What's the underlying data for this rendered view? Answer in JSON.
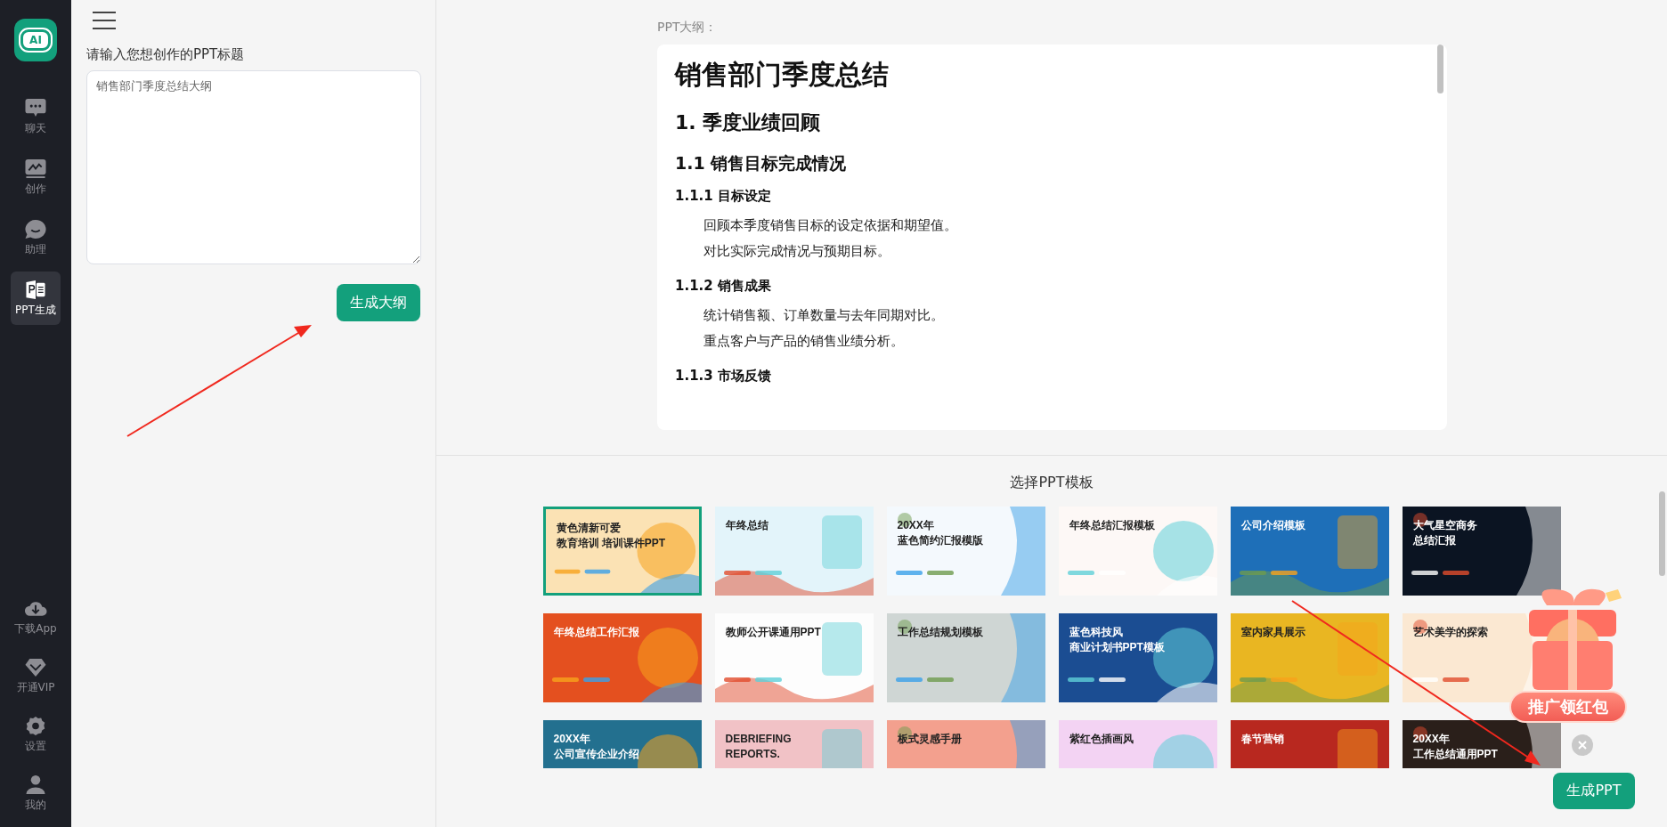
{
  "sidebar": {
    "logo": "AI",
    "items": [
      {
        "kind": "chat",
        "label": "聊天",
        "selected": false
      },
      {
        "kind": "create",
        "label": "创作",
        "selected": false
      },
      {
        "kind": "assistant",
        "label": "助理",
        "selected": false
      },
      {
        "kind": "ppt",
        "label": "PPT生成",
        "selected": true
      }
    ],
    "bottom_items": [
      {
        "kind": "download",
        "label": "下载App"
      },
      {
        "kind": "vip",
        "label": "开通VIP"
      },
      {
        "kind": "settings",
        "label": "设置"
      },
      {
        "kind": "user",
        "label": "我的"
      }
    ]
  },
  "left_panel": {
    "prompt_label": "请输入您想创作的PPT标题",
    "title_field": {
      "value": "销售部门季度总结大纲"
    },
    "generate_button": "生成大纲"
  },
  "outline": {
    "label": "PPT大纲：",
    "blocks": [
      {
        "kind": "h1",
        "text": "销售部门季度总结"
      },
      {
        "kind": "h2",
        "text": "1. 季度业绩回顾"
      },
      {
        "kind": "h3",
        "text": "1.1 销售目标完成情况"
      },
      {
        "kind": "h4",
        "text": "1.1.1 目标设定"
      },
      {
        "kind": "p",
        "text": "回顾本季度销售目标的设定依据和期望值。"
      },
      {
        "kind": "p",
        "text": "对比实际完成情况与预期目标。"
      },
      {
        "kind": "h4",
        "text": "1.1.2 销售成果"
      },
      {
        "kind": "p",
        "text": "统计销售额、订单数量与去年同期对比。"
      },
      {
        "kind": "p",
        "text": "重点客户与产品的销售业绩分析。"
      },
      {
        "kind": "h4",
        "text": "1.1.3 市场反馈"
      }
    ]
  },
  "templates": {
    "heading": "选择PPT模板",
    "items": [
      {
        "lines": [
          "黄色清新可爱",
          "教育培训 培训课件PPT"
        ],
        "color": "#fbe2b4",
        "selected": true
      },
      {
        "lines": [
          "年终总结"
        ],
        "color": "#e3f4fa",
        "selected": false
      },
      {
        "lines": [
          "20XX年",
          "蓝色简约汇报模版"
        ],
        "color": "#f4f9fd",
        "selected": false
      },
      {
        "lines": [
          "年终总结汇报模板"
        ],
        "color": "#fdf8f6",
        "selected": false
      },
      {
        "lines": [
          "公司介绍模板"
        ],
        "color": "#1e6fb8",
        "selected": false
      },
      {
        "lines": [
          "大气星空商务",
          "总结汇报"
        ],
        "color": "#0b1422",
        "selected": false
      },
      {
        "lines": [
          "年终总结工作汇报"
        ],
        "color": "#e4501f",
        "selected": false
      },
      {
        "lines": [
          "教师公开课通用PPT"
        ],
        "color": "#fdfdfd",
        "selected": false
      },
      {
        "lines": [
          "工作总结规划模板"
        ],
        "color": "#cfd6d4",
        "selected": false
      },
      {
        "lines": [
          "蓝色科技风",
          "商业计划书PPT模板"
        ],
        "color": "#1b4d92",
        "selected": false
      },
      {
        "lines": [
          "室内家具展示"
        ],
        "color": "#e9b622",
        "selected": false
      },
      {
        "lines": [
          "艺术美学的探索"
        ],
        "color": "#fbe8d2",
        "selected": false
      },
      {
        "lines": [
          "20XX年",
          "公司宣传企业介绍"
        ],
        "color": "#23708f",
        "selected": false
      },
      {
        "lines": [
          "DEBRIEFING",
          "REPORTS."
        ],
        "color": "#f1c2c6",
        "selected": false
      },
      {
        "lines": [
          "板式灵感手册"
        ],
        "color": "#f3a08e",
        "selected": false
      },
      {
        "lines": [
          "紫红色插画风"
        ],
        "color": "#f3d3f3",
        "selected": false
      },
      {
        "lines": [
          "春节营销"
        ],
        "color": "#b8281f",
        "selected": false
      },
      {
        "lines": [
          "20XX年",
          "工作总结通用PPT"
        ],
        "color": "#2a1f1a",
        "selected": false
      }
    ]
  },
  "promo": {
    "label": "推广领红包"
  },
  "generate_ppt_button": "生成PPT"
}
